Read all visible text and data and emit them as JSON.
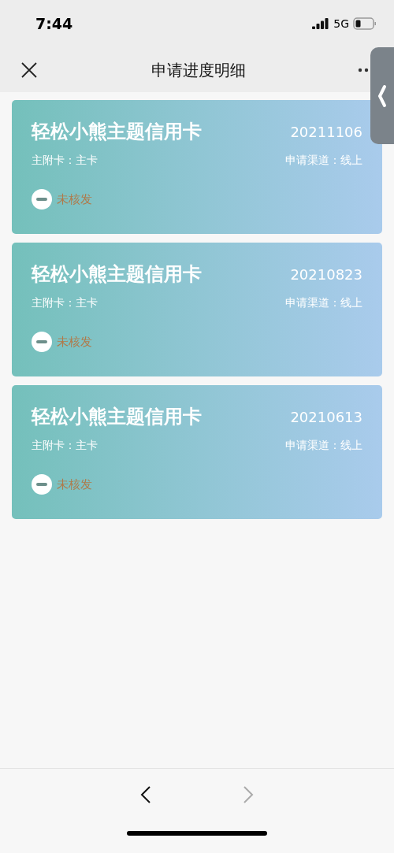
{
  "status_bar": {
    "time": "7:44",
    "network": "5G"
  },
  "nav_bar": {
    "title": "申请进度明细"
  },
  "applications": [
    {
      "card_name": "轻松小熊主题信用卡",
      "date": "20211106",
      "card_type": "主附卡：主卡",
      "channel": "申请渠道：线上",
      "status": "未核发"
    },
    {
      "card_name": "轻松小熊主题信用卡",
      "date": "20210823",
      "card_type": "主附卡：主卡",
      "channel": "申请渠道：线上",
      "status": "未核发"
    },
    {
      "card_name": "轻松小熊主题信用卡",
      "date": "20210613",
      "card_type": "主附卡：主卡",
      "channel": "申请渠道：线上",
      "status": "未核发"
    }
  ],
  "toolbar": {
    "back_disabled": false,
    "forward_disabled": true
  }
}
